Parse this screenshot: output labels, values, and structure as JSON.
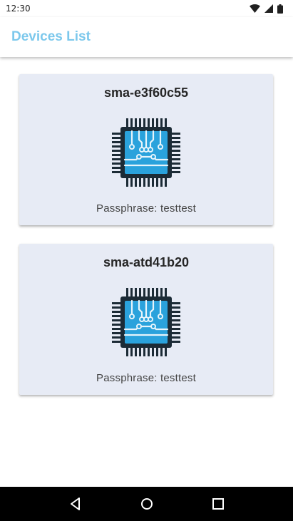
{
  "status_bar": {
    "time": "12:30"
  },
  "app_bar": {
    "title": "Devices List"
  },
  "devices": [
    {
      "name": "sma-e3f60c55",
      "passphrase": "Passphrase: testtest",
      "icon": "chip-icon"
    },
    {
      "name": "sma-atd41b20",
      "passphrase": "Passphrase: testtest",
      "icon": "chip-icon"
    }
  ],
  "colors": {
    "accent": "#7cc8ec",
    "card_bg": "#e7ebf5",
    "chip_blue": "#2aa2dc",
    "chip_dark": "#1c2b36"
  }
}
